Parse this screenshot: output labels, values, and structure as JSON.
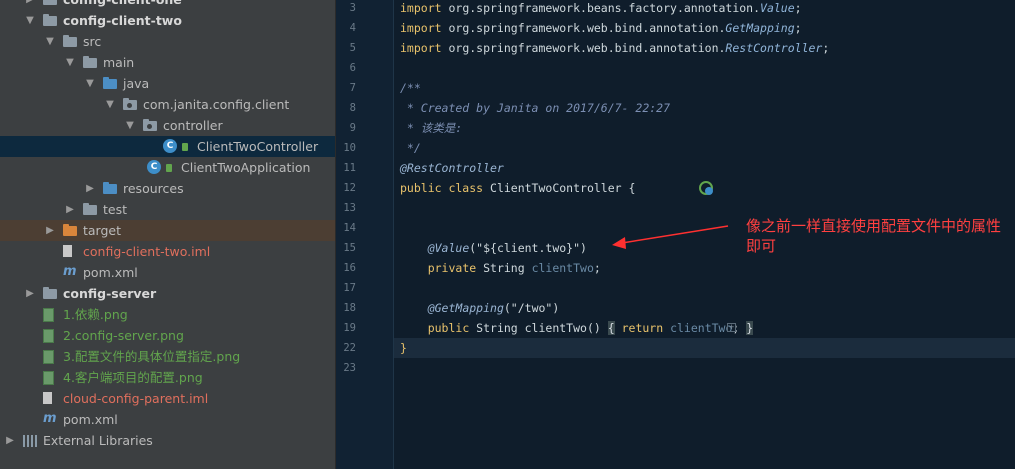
{
  "project_tree": {
    "rows": [
      {
        "label": "config-client-one",
        "indent": 1,
        "expander": "closed",
        "icon": "module-folder-icon",
        "style": "bold"
      },
      {
        "label": "config-client-two",
        "indent": 1,
        "expander": "open",
        "icon": "module-folder-icon",
        "style": "bold"
      },
      {
        "label": "src",
        "indent": 2,
        "expander": "open",
        "icon": "folder-icon"
      },
      {
        "label": "main",
        "indent": 3,
        "expander": "open",
        "icon": "folder-icon"
      },
      {
        "label": "java",
        "indent": 4,
        "expander": "open",
        "icon": "source-folder-icon"
      },
      {
        "label": "com.janita.config.client",
        "indent": 5,
        "expander": "open",
        "icon": "package-icon"
      },
      {
        "label": "controller",
        "indent": 6,
        "expander": "open",
        "icon": "package-icon"
      },
      {
        "label": "ClientTwoController",
        "indent": 7,
        "expander": "none",
        "icon": "java-class-icon",
        "selected": true
      },
      {
        "label": "ClientTwoApplication",
        "indent": 6,
        "expander": "none",
        "icon": "spring-boot-class-icon",
        "nudge": 4
      },
      {
        "label": "resources",
        "indent": 4,
        "expander": "closed",
        "icon": "resources-folder-icon"
      },
      {
        "label": "test",
        "indent": 3,
        "expander": "closed",
        "icon": "folder-icon"
      },
      {
        "label": "target",
        "indent": 2,
        "expander": "closed",
        "icon": "excluded-folder-icon",
        "highlight": true
      },
      {
        "label": "config-client-two.iml",
        "indent": 2,
        "expander": "none",
        "icon": "iml-file-icon",
        "color": "red"
      },
      {
        "label": "pom.xml",
        "indent": 2,
        "expander": "none",
        "icon": "maven-icon"
      },
      {
        "label": "config-server",
        "indent": 1,
        "expander": "closed",
        "icon": "module-folder-icon",
        "style": "bold"
      },
      {
        "label": "1.依赖.png",
        "indent": 1,
        "expander": "none",
        "icon": "image-file-icon",
        "color": "green"
      },
      {
        "label": "2.config-server.png",
        "indent": 1,
        "expander": "none",
        "icon": "image-file-icon",
        "color": "green"
      },
      {
        "label": "3.配置文件的具体位置指定.png",
        "indent": 1,
        "expander": "none",
        "icon": "image-file-icon",
        "color": "green"
      },
      {
        "label": "4.客户端项目的配置.png",
        "indent": 1,
        "expander": "none",
        "icon": "image-file-icon",
        "color": "green"
      },
      {
        "label": "cloud-config-parent.iml",
        "indent": 1,
        "expander": "none",
        "icon": "iml-file-icon",
        "color": "red"
      },
      {
        "label": "pom.xml",
        "indent": 1,
        "expander": "none",
        "icon": "maven-icon"
      },
      {
        "label": "External Libraries",
        "indent": 0,
        "expander": "closed",
        "icon": "libraries-icon"
      }
    ]
  },
  "editor": {
    "current_line": "22",
    "lines": [
      {
        "n": "3",
        "tokens": [
          [
            "kw",
            "import "
          ],
          [
            "pkg",
            "org.springframework.beans.factory.annotation."
          ],
          [
            "ital",
            "Value"
          ],
          [
            "pkg",
            ";"
          ]
        ]
      },
      {
        "n": "4",
        "tokens": [
          [
            "kw",
            "import "
          ],
          [
            "pkg",
            "org.springframework.web.bind.annotation."
          ],
          [
            "ital",
            "GetMapping"
          ],
          [
            "pkg",
            ";"
          ]
        ]
      },
      {
        "n": "5",
        "tokens": [
          [
            "kw",
            "import "
          ],
          [
            "pkg",
            "org.springframework.web.bind.annotation."
          ],
          [
            "ital",
            "RestController"
          ],
          [
            "pkg",
            ";"
          ]
        ]
      },
      {
        "n": "6",
        "tokens": []
      },
      {
        "n": "7",
        "tokens": [
          [
            "cmt",
            "/**"
          ]
        ]
      },
      {
        "n": "8",
        "tokens": [
          [
            "cmt",
            " * Created by Janita on 2017/6/7- 22:27"
          ]
        ]
      },
      {
        "n": "9",
        "tokens": [
          [
            "cmt",
            " * 该类是:"
          ]
        ]
      },
      {
        "n": "10",
        "tokens": [
          [
            "cmt",
            " */"
          ]
        ]
      },
      {
        "n": "11",
        "tokens": [
          [
            "ann",
            "@RestController"
          ]
        ]
      },
      {
        "n": "12",
        "tokens": [
          [
            "kw",
            "public class "
          ],
          [
            "pkg",
            "ClientTwoController {"
          ]
        ]
      },
      {
        "n": "13",
        "tokens": []
      },
      {
        "n": "14",
        "tokens": []
      },
      {
        "n": "15",
        "tokens": [
          [
            "pkg",
            "    "
          ],
          [
            "ann",
            "@Value"
          ],
          [
            "str",
            "(\"${client.two}\")"
          ]
        ]
      },
      {
        "n": "16",
        "tokens": [
          [
            "pkg",
            "    "
          ],
          [
            "kw",
            "private "
          ],
          [
            "pkg",
            "String "
          ],
          [
            "field",
            "clientTwo"
          ],
          [
            "pkg",
            ";"
          ]
        ]
      },
      {
        "n": "17",
        "tokens": []
      },
      {
        "n": "18",
        "tokens": [
          [
            "pkg",
            "    "
          ],
          [
            "ann",
            "@GetMapping"
          ],
          [
            "str",
            "(\"/two\")"
          ]
        ]
      },
      {
        "n": "19",
        "tokens": [
          [
            "pkg",
            "    "
          ],
          [
            "kw",
            "public "
          ],
          [
            "pkg",
            "String clientTwo() "
          ],
          [
            "brace",
            "{"
          ],
          [
            "pkg",
            " "
          ],
          [
            "kw",
            "return "
          ],
          [
            "field",
            "clientTwo"
          ],
          [
            "pkg",
            "; "
          ],
          [
            "brace",
            "}"
          ]
        ]
      },
      {
        "n": "22",
        "tokens": [
          [
            "kw",
            "}"
          ]
        ]
      },
      {
        "n": "23",
        "tokens": []
      }
    ]
  },
  "annotation_note": "像之前一样直接使用配置文件中的属性即可",
  "colors": {
    "note": "#ff4040",
    "selection": "#0d293e",
    "editor_bg": "#0f1d2b"
  }
}
